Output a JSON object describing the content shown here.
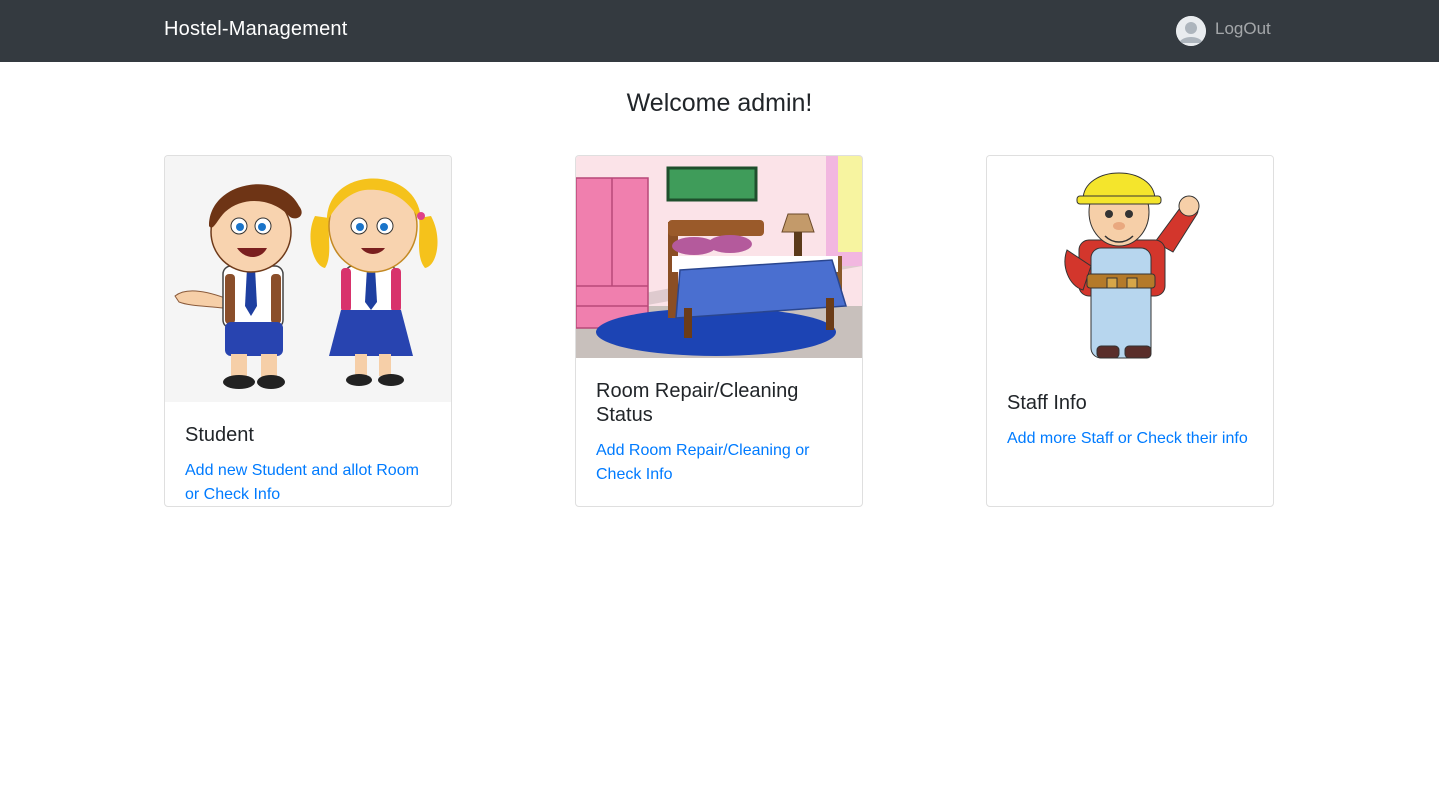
{
  "navbar": {
    "brand": "Hostel-Management",
    "logout_label": "LogOut",
    "avatar_icon": "user-avatar-icon",
    "background": "#343a40"
  },
  "welcome": "Welcome admin!",
  "cards": [
    {
      "title": "Student",
      "link": "Add new Student and allot Room or Check Info",
      "image": "students-illustration"
    },
    {
      "title": "Room Repair/Cleaning Status",
      "link": "Add Room Repair/Cleaning or Check Info",
      "image": "bedroom-illustration"
    },
    {
      "title": "Staff Info",
      "link": "Add more Staff or Check their info",
      "image": "worker-illustration"
    }
  ],
  "colors": {
    "link": "#007bff",
    "text": "#212529"
  }
}
